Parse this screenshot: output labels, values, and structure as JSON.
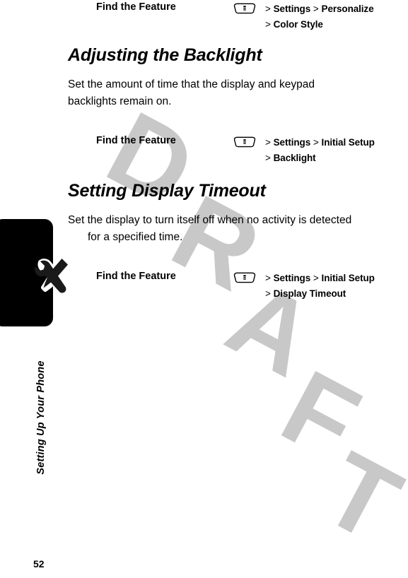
{
  "document": {
    "page_number": "52",
    "chapter_label": "Setting Up Your Phone",
    "watermark_text": "DRAFT",
    "watermark_letters": [
      "D",
      "R",
      "A",
      "F",
      "T"
    ],
    "colors": {
      "text": "#000000",
      "watermark": "#c8c8c8",
      "tab": "#000000",
      "page_background": "#ffffff"
    }
  },
  "sidebar": {
    "tab_icon_name": "tools-wrench-screwdriver-icon",
    "label": "Setting Up Your Phone"
  },
  "blocks": [
    {
      "label": "Find the Feature",
      "icon_name": "menu-key-icon",
      "path_lines": [
        {
          "prefix": ">",
          "items": [
            "Settings",
            "Personalize"
          ]
        },
        {
          "prefix": ">",
          "items": [
            "Color Style"
          ]
        }
      ]
    },
    {
      "label": "Find the Feature",
      "icon_name": "menu-key-icon",
      "path_lines": [
        {
          "prefix": ">",
          "items": [
            "Settings",
            "Initial Setup"
          ]
        },
        {
          "prefix": ">",
          "items": [
            "Backlight"
          ]
        }
      ]
    },
    {
      "label": "Find the Feature",
      "icon_name": "menu-key-icon",
      "path_lines": [
        {
          "prefix": ">",
          "items": [
            "Settings",
            "Initial Setup"
          ]
        },
        {
          "prefix": ">",
          "items": [
            "Display Timeout"
          ]
        }
      ]
    }
  ],
  "sections": [
    {
      "heading": "Adjusting the Backlight",
      "paragraph_lines": [
        {
          "text": "Set the amount of time that the display and keypad",
          "indent": false
        },
        {
          "text": "backlights remain on.",
          "indent": false
        }
      ]
    },
    {
      "heading": "Setting Display Timeout",
      "paragraph_lines": [
        {
          "text": "Set the display to turn itself off when no activity is detected",
          "indent": false
        },
        {
          "text": "for a specified time.",
          "indent": true
        }
      ]
    }
  ]
}
